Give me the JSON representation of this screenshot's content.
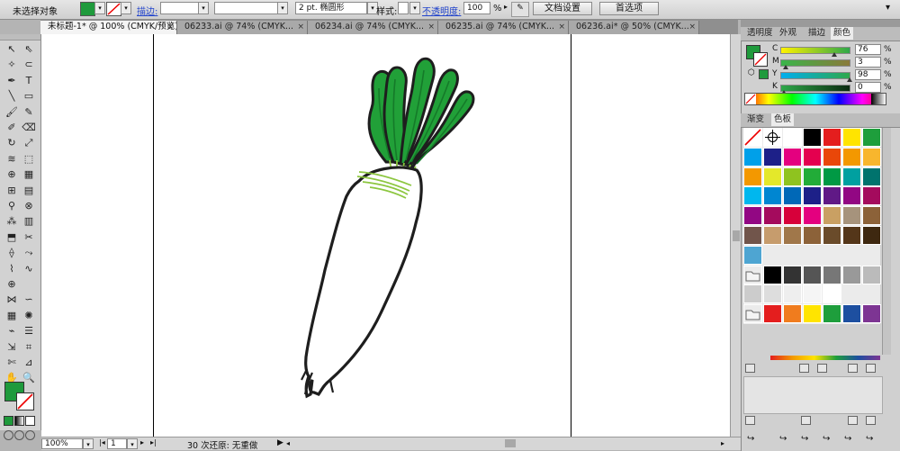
{
  "control_bar": {
    "selection_label": "未选择对象",
    "stroke_label": "描边:",
    "stroke_weight": "",
    "brush_value": "2 pt. 椭圆形",
    "style_label": "样式:",
    "opacity_label": "不透明度:",
    "opacity_value": "100",
    "opacity_unit": "%",
    "doc_setup_button": "文档设置",
    "prefs_button": "首选项"
  },
  "tabs": [
    {
      "label": "未标题-1* @ 100% (CMYK/预览)",
      "close": "×"
    },
    {
      "label": "06233.ai @ 74% (CMYK...",
      "close": "×"
    },
    {
      "label": "06234.ai @ 74% (CMYK...",
      "close": "×"
    },
    {
      "label": "06235.ai @ 74% (CMYK...",
      "close": "×"
    },
    {
      "label": "06236.ai* @ 50% (CMYK...",
      "close": "×"
    }
  ],
  "color_panel": {
    "tabs": [
      "透明度",
      "外观",
      "描边",
      "颜色"
    ],
    "active_tab": "颜色",
    "channels": [
      {
        "label": "C",
        "value": "76",
        "unit": "%",
        "level": 76
      },
      {
        "label": "M",
        "value": "3",
        "unit": "%",
        "level": 3
      },
      {
        "label": "Y",
        "value": "98",
        "unit": "%",
        "level": 98
      },
      {
        "label": "K",
        "value": "0",
        "unit": "%",
        "level": 0
      }
    ],
    "fill_color": "#1f9a3c"
  },
  "swatches_panel": {
    "tabs": [
      "渐变",
      "色板"
    ],
    "active_tab": "色板",
    "rows": [
      [
        "none",
        "registration",
        "#ffffff",
        "#000000",
        "#e41e1e",
        "#ffe400",
        "#1e9e3c"
      ],
      [
        "#00a0e9",
        "#1d2088",
        "#e4007f",
        "#e4004f",
        "#e94709",
        "#f39800",
        "#f8b62d"
      ],
      [
        "#f39800",
        "#e4e82a",
        "#8fc31f",
        "#22ac38",
        "#009944",
        "#00a0a0",
        "#00736d"
      ],
      [
        "#00b7ee",
        "#0086d1",
        "#0068b7",
        "#1d2088",
        "#601986",
        "#920783",
        "#a40b5d"
      ],
      [
        "#920783",
        "#a40b5d",
        "#d7003a",
        "#e4007f",
        "#c9a063",
        "#a6937c",
        "#8c6239"
      ],
      [
        "#71554b",
        "#c69c6d",
        "#a0774a",
        "#8c6239",
        "#6a4b2a",
        "#543619",
        "#3e2810"
      ],
      [
        "#4ea5d2"
      ],
      [
        "folder",
        "#000000",
        "#333333",
        "#555555",
        "#777777",
        "#999999",
        "#bbbbbb"
      ],
      [
        "#cccccc",
        "#dddddd",
        "#eeeeee",
        "#f5f5f5",
        "#ffffff"
      ],
      [
        "folder",
        "#e41e1e",
        "#f07c1e",
        "#ffe400",
        "#1e9e3c",
        "#1d4fa0",
        "#7d3593"
      ]
    ]
  },
  "status_bar": {
    "zoom": "100%",
    "page": "1",
    "status_text": "30 次还原: 无重做"
  },
  "artwork": {
    "root_fill": "#ffffff",
    "outline": "#1e1e1e",
    "leaf_fill": "#21a038",
    "leaf_vein": "#157a29",
    "neck_lines": "#8cc63f"
  }
}
